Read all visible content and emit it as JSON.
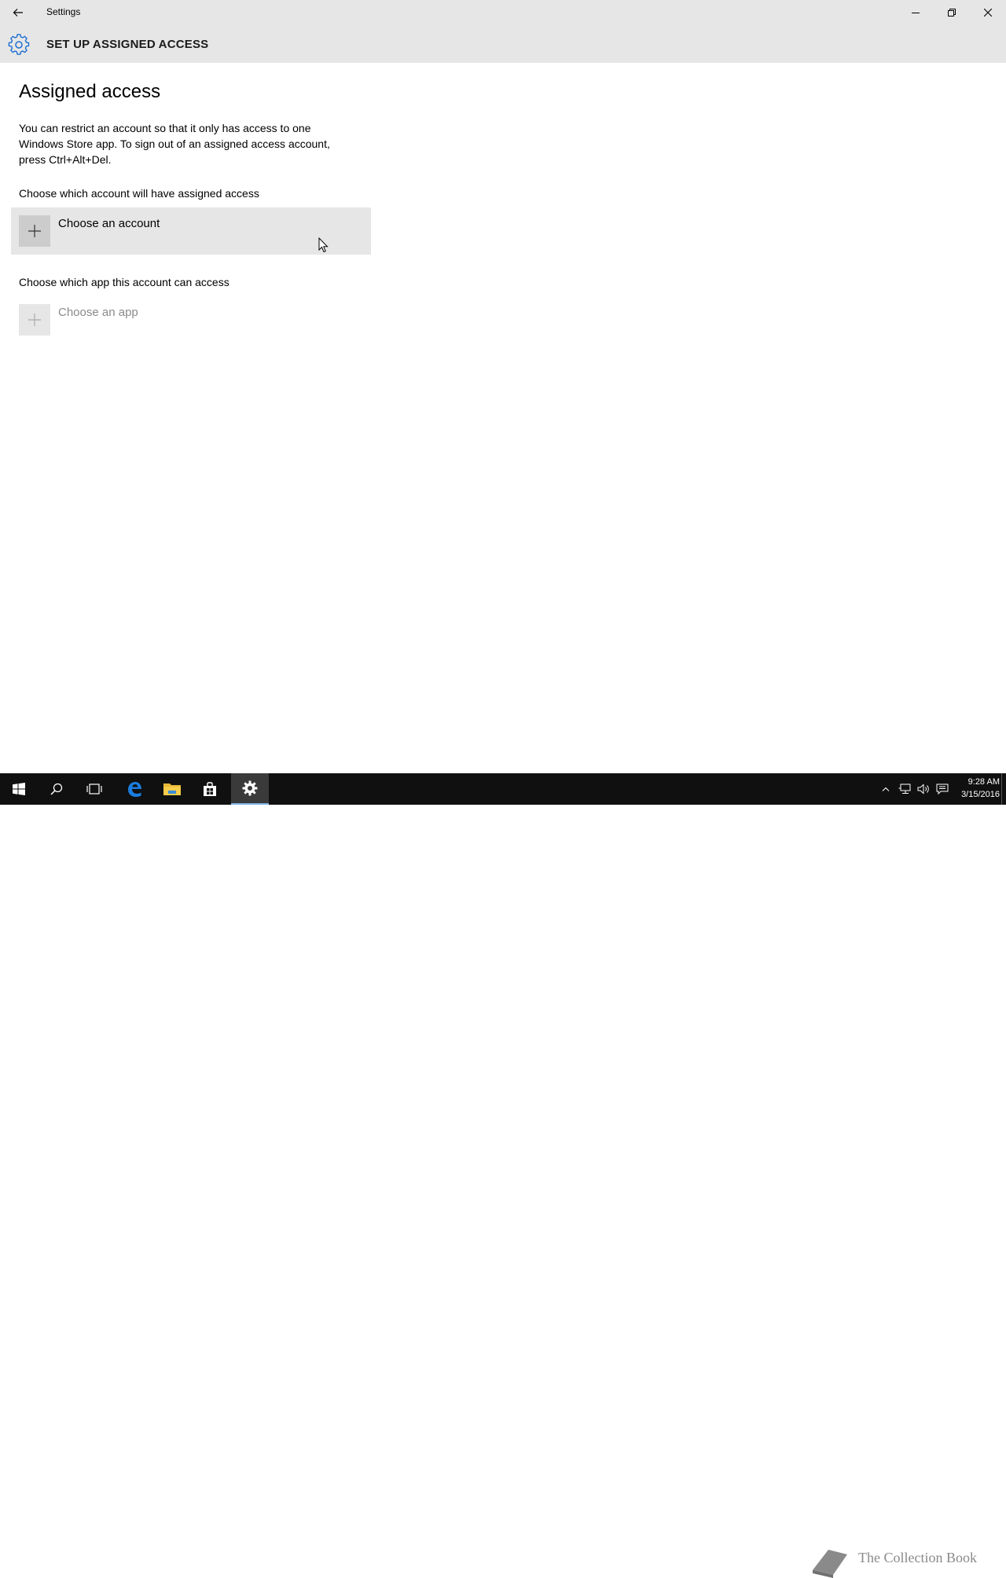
{
  "window": {
    "title": "Settings",
    "back_icon": "back-arrow-icon",
    "controls": [
      "minimize-icon",
      "restore-icon",
      "close-icon"
    ]
  },
  "header": {
    "icon": "gear-icon",
    "title": "SET UP ASSIGNED ACCESS",
    "accent_color": "#1e6fd1"
  },
  "content": {
    "page_title": "Assigned access",
    "description": "You can restrict an account so that it only has access to one Windows Store app. To sign out of an assigned access account, press Ctrl+Alt+Del.",
    "account_section": {
      "label": "Choose which account will have assigned access",
      "button_label": "Choose an account"
    },
    "app_section": {
      "label": "Choose which app this account can access",
      "button_label": "Choose an app",
      "disabled": true
    }
  },
  "taskbar": {
    "items": [
      "start-icon",
      "search-icon",
      "task-view-icon",
      "edge-icon",
      "file-explorer-icon",
      "store-icon",
      "settings-icon"
    ],
    "active": "settings-icon",
    "tray_icons": [
      "chevron-up-icon",
      "network-icon",
      "volume-icon",
      "action-center-icon"
    ],
    "time": "9:28 AM",
    "date": "3/15/2016"
  },
  "watermark": {
    "text": "The Collection Book"
  }
}
